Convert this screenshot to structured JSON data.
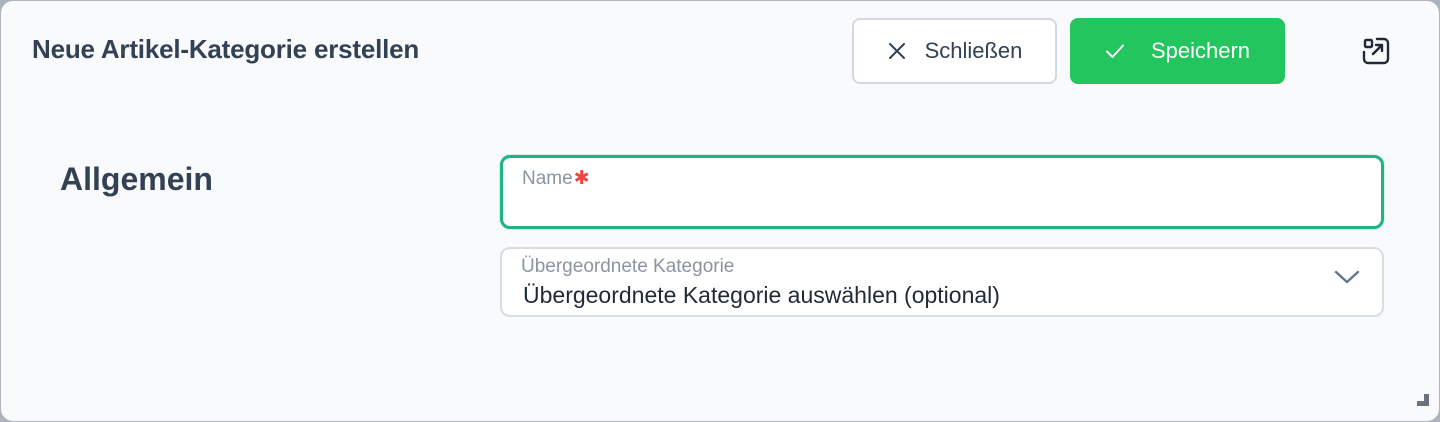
{
  "dialog": {
    "title": "Neue Artikel-Kategorie erstellen",
    "close_label": "Schließen",
    "save_label": "Speichern",
    "close_icon": "x-icon",
    "save_icon": "check-icon",
    "expand_icon": "expand-icon"
  },
  "section": {
    "title": "Allgemein"
  },
  "form": {
    "name": {
      "label": "Name",
      "required_marker": "✱",
      "value": ""
    },
    "parent_category": {
      "label": "Übergeordnete Kategorie",
      "selected": "Übergeordnete Kategorie auswählen (optional)"
    }
  },
  "colors": {
    "accent_green": "#22c55e",
    "focus_ring": "#1fb482",
    "required": "#ef4444",
    "text": "#334155",
    "background": "#f8fafc"
  }
}
